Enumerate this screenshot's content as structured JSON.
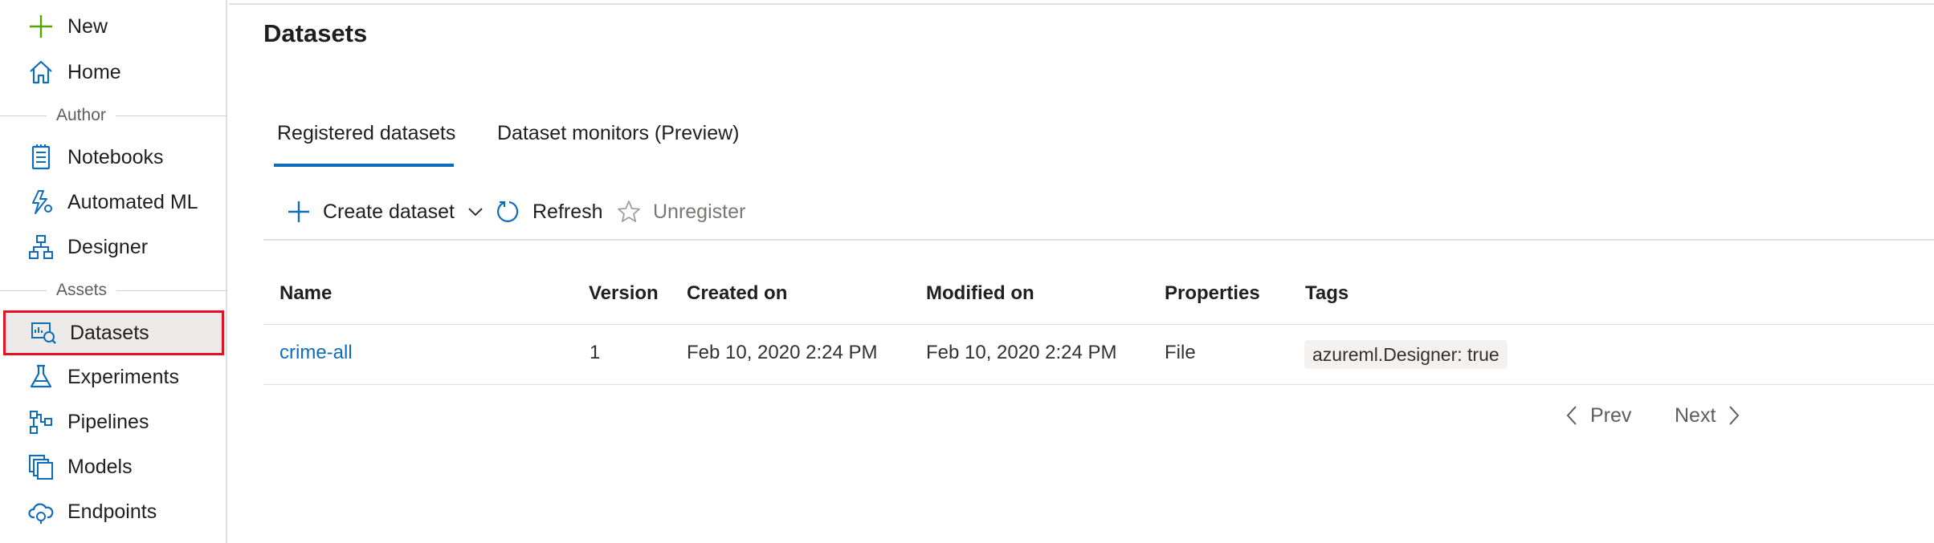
{
  "sidebar": {
    "new_label": "New",
    "home_label": "Home",
    "author_section": "Author",
    "notebooks_label": "Notebooks",
    "automl_label": "Automated ML",
    "designer_label": "Designer",
    "assets_section": "Assets",
    "datasets_label": "Datasets",
    "experiments_label": "Experiments",
    "pipelines_label": "Pipelines",
    "models_label": "Models",
    "endpoints_label": "Endpoints",
    "selected": "Datasets"
  },
  "page": {
    "title": "Datasets"
  },
  "tabs": [
    {
      "label": "Registered datasets",
      "active": true
    },
    {
      "label": "Dataset monitors (Preview)",
      "active": false
    }
  ],
  "toolbar": {
    "create_label": "Create dataset",
    "refresh_label": "Refresh",
    "unregister_label": "Unregister"
  },
  "table": {
    "columns": [
      "Name",
      "Version",
      "Created on",
      "Modified on",
      "Properties",
      "Tags"
    ],
    "rows": [
      {
        "name": "crime-all",
        "version": "1",
        "created_on": "Feb 10, 2020 2:24 PM",
        "modified_on": "Feb 10, 2020 2:24 PM",
        "properties": "File",
        "tags": "azureml.Designer: true"
      }
    ]
  },
  "pagination": {
    "prev_label": "Prev",
    "next_label": "Next"
  },
  "colors": {
    "accent": "#0f6cbd",
    "new_icon": "#57a300",
    "selection_outline": "#e81123",
    "selected_bg": "#edebe9"
  }
}
